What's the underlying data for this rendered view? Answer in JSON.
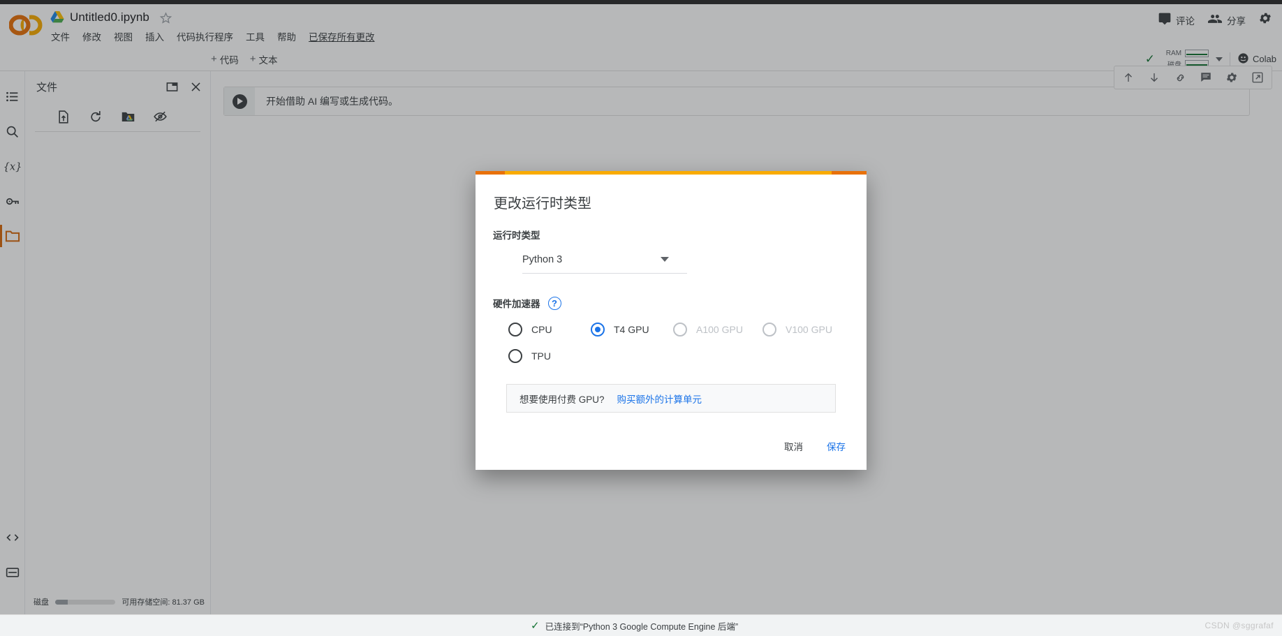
{
  "header": {
    "notebook_title": "Untitled0.ipynb",
    "logo_text": "CO",
    "drive_icon": "drive-icon",
    "star_icon": "star-icon",
    "menu": [
      "文件",
      "修改",
      "视图",
      "插入",
      "代码执行程序",
      "工具",
      "帮助"
    ],
    "saved_note": "已保存所有更改",
    "comment_label": "评论",
    "share_label": "分享",
    "comment_icon": "comment-icon",
    "share_icon": "people-icon",
    "settings_icon": "gear-icon"
  },
  "toolbar": {
    "add_code": "代码",
    "add_text": "文本",
    "plus": "+",
    "ram_label": "RAM",
    "disk_label": "磁盘",
    "connected_check": "✓",
    "colab_label": "Colab",
    "colab_icon": "colab-pro-icon",
    "dropdown_icon": "chevron-down-icon"
  },
  "rail": {
    "items": [
      {
        "name": "toc-icon",
        "label": "目录"
      },
      {
        "name": "search-icon",
        "label": "查找和替换"
      },
      {
        "name": "variables-icon",
        "label": "变量"
      },
      {
        "name": "secrets-key-icon",
        "label": "密钥"
      },
      {
        "name": "files-folder-icon",
        "label": "文件",
        "active": true
      }
    ],
    "bottom_items": [
      {
        "name": "code-snippets-icon",
        "label": "代码段"
      },
      {
        "name": "terminal-icon",
        "label": "终端"
      }
    ]
  },
  "files_panel": {
    "title": "文件",
    "new_window_icon": "open-in-new-window-icon",
    "close_icon": "close-icon",
    "tools": [
      {
        "name": "upload-file-icon",
        "label": "上传到会话存储空间"
      },
      {
        "name": "refresh-icon",
        "label": "刷新"
      },
      {
        "name": "mount-drive-icon",
        "label": "装载云端硬盘"
      },
      {
        "name": "toggle-hidden-icon",
        "label": "显示/隐藏隐藏文件"
      }
    ],
    "disk_label": "磁盘",
    "disk_text": "可用存储空间: 81.37 GB",
    "disk_fill_pct": 21
  },
  "notebook": {
    "cell_placeholder": "开始借助 AI 编写或生成代码。",
    "run_icon": "run-cell-icon",
    "cell_tools": [
      {
        "name": "move-cell-up-icon"
      },
      {
        "name": "move-cell-down-icon"
      },
      {
        "name": "link-to-cell-icon"
      },
      {
        "name": "add-comment-icon"
      },
      {
        "name": "cell-settings-icon"
      },
      {
        "name": "open-in-new-tab-icon"
      }
    ]
  },
  "status_bar": {
    "check": "✓",
    "text": "已连接到“Python 3 Google Compute Engine 后端”",
    "watermark": "CSDN @sggrafaf"
  },
  "dialog": {
    "title": "更改运行时类型",
    "runtime_label": "运行时类型",
    "runtime_value": "Python 3",
    "runtime_caret_icon": "chevron-down-icon",
    "accelerator_label": "硬件加速器",
    "help_icon_glyph": "?",
    "options": [
      {
        "label": "CPU",
        "selected": false,
        "disabled": false
      },
      {
        "label": "T4 GPU",
        "selected": true,
        "disabled": false
      },
      {
        "label": "A100 GPU",
        "selected": false,
        "disabled": true
      },
      {
        "label": "V100 GPU",
        "selected": false,
        "disabled": true
      },
      {
        "label": "TPU",
        "selected": false,
        "disabled": false
      }
    ],
    "notice_text": "想要使用付费 GPU?",
    "notice_link": "购买额外的计算单元",
    "cancel_label": "取消",
    "save_label": "保存",
    "accent_orange": "#e8710a",
    "accent_amber": "#f9ab00",
    "accent_blue": "#1a73e8"
  }
}
